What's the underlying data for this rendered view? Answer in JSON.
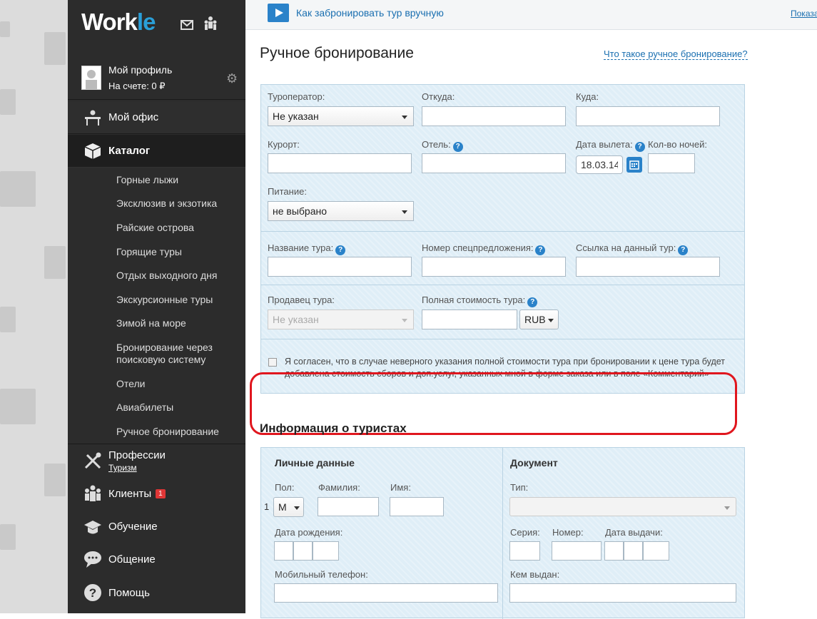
{
  "app": {
    "logo_main": "Work",
    "logo_accent": "le"
  },
  "profile": {
    "name": "Мой профиль",
    "balance": "На счете: 0 ₽"
  },
  "nav": {
    "office": "Мой офис",
    "catalog": "Каталог",
    "catalog_items": [
      "Горные лыжи",
      "Эксклюзив и экзотика",
      "Райские острова",
      "Горящие туры",
      "Отдых выходного дня",
      "Экскурсионные туры",
      "Зимой на море",
      "Бронирование через поисковую систему",
      "Отели",
      "Авиабилеты",
      "Ручное бронирование"
    ],
    "professions": "Профессии",
    "professions_sub": "Туризм",
    "clients": "Клиенты",
    "clients_badge": "1",
    "learning": "Обучение",
    "communication": "Общение",
    "help": "Помощь"
  },
  "topbar": {
    "howto": "Как забронировать тур вручную",
    "show": "Показат"
  },
  "page": {
    "title": "Ручное бронирование",
    "what_link": "Что такое ручное бронирование?"
  },
  "form": {
    "operator_label": "Туроператор:",
    "operator_value": "Не указан",
    "from_label": "Откуда:",
    "to_label": "Куда:",
    "resort_label": "Курорт:",
    "hotel_label": "Отель:",
    "date_label": "Дата вылета:",
    "date_value": "18.03.14",
    "nights_label": "Кол-во ночей:",
    "meal_label": "Питание:",
    "meal_value": "не выбрано",
    "tourname_label": "Название тура:",
    "offer_label": "Номер спецпредложения:",
    "link_label": "Ссылка на данный тур:",
    "seller_label": "Продавец тура:",
    "seller_value": "Не указан",
    "price_label": "Полная стоимость тура:",
    "currency": "RUB",
    "agree_text": "Я согласен, что в случае неверного указания полной стоимости тура при бронировании к цене тура будет добавлена стоимость сборов и доп.услуг, указанных мной в форме заказа или в поле «Комментарий»"
  },
  "tourists": {
    "title": "Информация о туристах",
    "personal_title": "Личные данные",
    "document_title": "Документ",
    "sex_label": "Пол:",
    "sex_value": "М",
    "row_num": "1",
    "surname_label": "Фамилия:",
    "name_label": "Имя:",
    "birth_label": "Дата рождения:",
    "phone_label": "Мобильный телефон:",
    "type_label": "Тип:",
    "series_label": "Серия:",
    "number_label": "Номер:",
    "issue_date_label": "Дата выдачи:",
    "issued_by_label": "Кем выдан:"
  },
  "colors": {
    "sidebar": "#2c2c2c",
    "accent": "#2a82c9",
    "panel": "#dfeef7",
    "highlight": "#e0161e"
  }
}
